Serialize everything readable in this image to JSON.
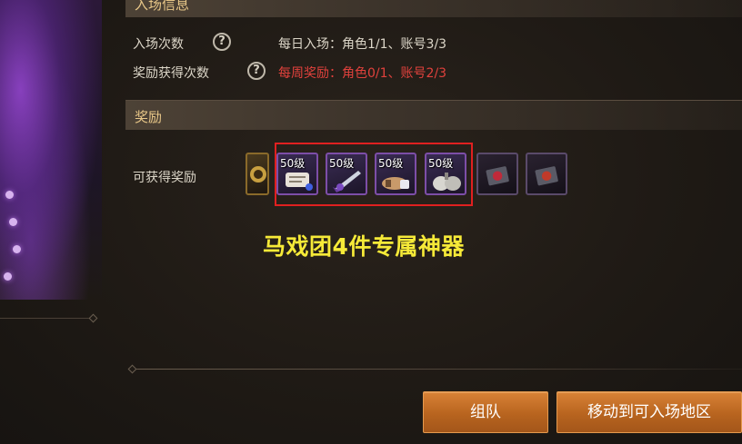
{
  "sections": {
    "entry_title": "入场信息",
    "reward_title": "奖励"
  },
  "entry": {
    "count_label": "入场次数",
    "count_value": "每日入场：角色1/1、账号3/3",
    "reward_count_label": "奖励获得次数",
    "reward_count_value": "每周奖励：角色0/1、账号2/3",
    "help_glyph": "?"
  },
  "reward": {
    "label": "可获得奖励",
    "items": [
      {
        "name": "partial-item",
        "level": ""
      },
      {
        "name": "scroll-item",
        "level": "50级"
      },
      {
        "name": "weapon-item",
        "level": "50级"
      },
      {
        "name": "arm-item",
        "level": "50级"
      },
      {
        "name": "pouch-item",
        "level": "50级"
      },
      {
        "name": "box-item-1",
        "level": ""
      },
      {
        "name": "box-item-2",
        "level": ""
      }
    ]
  },
  "annotation": "马戏团4件专属神器",
  "buttons": {
    "team": "组队",
    "move": "移动到可入场地区"
  },
  "colors": {
    "section_title": "#e8c788",
    "warning_text": "#e0413c",
    "annotation": "#f6ea38",
    "highlight_border": "#e02020",
    "button": "#c8732a"
  }
}
